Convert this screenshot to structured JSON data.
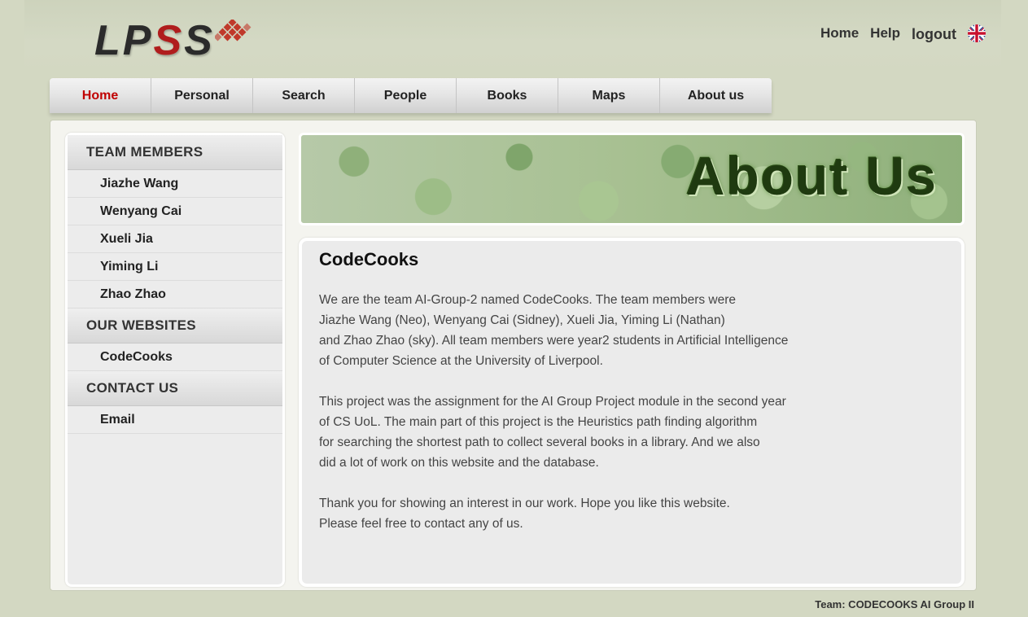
{
  "logo": {
    "text_part1": "LP",
    "text_red": "S",
    "text_part2": "S"
  },
  "toplinks": {
    "home": "Home",
    "help": "Help",
    "logout": "logout"
  },
  "nav": [
    "Home",
    "Personal",
    "Search",
    "People",
    "Books",
    "Maps",
    "About us"
  ],
  "nav_active": "Home",
  "sidebar": {
    "team_heading": "TEAM MEMBERS",
    "team": [
      "Jiazhe Wang",
      "Wenyang Cai",
      "Xueli Jia",
      "Yiming Li",
      "Zhao Zhao"
    ],
    "websites_heading": "OUR WEBSITES",
    "websites": [
      "CodeCooks"
    ],
    "contact_heading": "CONTACT US",
    "contact": [
      "Email"
    ]
  },
  "banner": {
    "title": "About Us"
  },
  "content": {
    "title": "CodeCooks",
    "p1": [
      "We are the team AI-Group-2 named CodeCooks. The team members were",
      "Jiazhe Wang (Neo), Wenyang Cai (Sidney), Xueli Jia, Yiming Li (Nathan)",
      "and Zhao Zhao (sky). All team members were year2 students in Artificial Intelligence",
      "of Computer Science at the University of Liverpool."
    ],
    "p2": [
      "This project was the assignment for the AI Group Project module in the second year",
      "of CS UoL. The main part of this project is the Heuristics path finding algorithm",
      "for searching the shortest path to collect several books in a library. And we also",
      "did a lot of work on this website and the database."
    ],
    "p3": [
      "Thank you for showing an interest in our work. Hope you like this website.",
      "Please feel free to contact any of us."
    ]
  },
  "footer": "Team: CODECOOKS AI Group II",
  "colors": {
    "accent_red": "#c00000",
    "logo_red": "#b01d1d",
    "background": "#d3d8c2"
  },
  "icons": {
    "flag": "uk-flag-icon",
    "logo_mark": "diamond-grid-icon"
  }
}
